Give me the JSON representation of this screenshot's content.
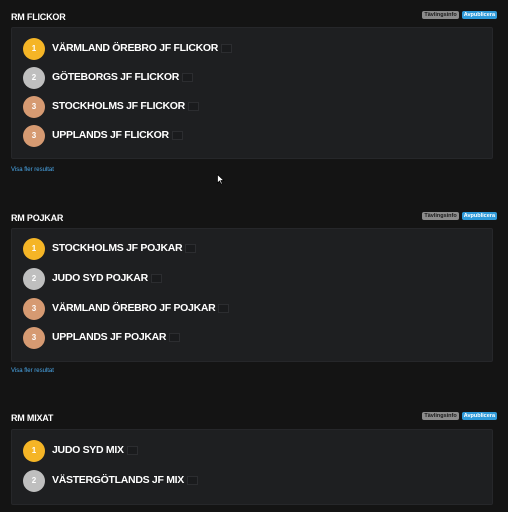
{
  "sections": [
    {
      "title": "RM FLICKOR",
      "badges": [
        "Tävlingsinfo",
        "Avpublicera"
      ],
      "results": [
        {
          "place": "1",
          "medal": "gold",
          "team": "VÄRMLAND ÖREBRO JF FLICKOR"
        },
        {
          "place": "2",
          "medal": "silver",
          "team": "GÖTEBORGS JF FLICKOR"
        },
        {
          "place": "3",
          "medal": "bronze",
          "team": "STOCKHOLMS JF FLICKOR"
        },
        {
          "place": "3",
          "medal": "bronze",
          "team": "UPPLANDS JF FLICKOR"
        }
      ],
      "more_link": "Visa fler resultat"
    },
    {
      "title": "RM POJKAR",
      "badges": [
        "Tävlingsinfo",
        "Avpublicera"
      ],
      "results": [
        {
          "place": "1",
          "medal": "gold",
          "team": "STOCKHOLMS JF POJKAR"
        },
        {
          "place": "2",
          "medal": "silver",
          "team": "JUDO SYD POJKAR"
        },
        {
          "place": "3",
          "medal": "bronze",
          "team": "VÄRMLAND ÖREBRO JF POJKAR"
        },
        {
          "place": "3",
          "medal": "bronze",
          "team": "UPPLANDS JF POJKAR"
        }
      ],
      "more_link": "Visa fler resultat"
    },
    {
      "title": "RM MIXAT",
      "badges": [
        "Tävlingsinfo",
        "Avpublicera"
      ],
      "results": [
        {
          "place": "1",
          "medal": "gold",
          "team": "JUDO SYD MIX"
        },
        {
          "place": "2",
          "medal": "silver",
          "team": "VÄSTERGÖTLANDS JF MIX"
        }
      ]
    }
  ],
  "colors": {
    "background": "#141414",
    "card": "#1e1f21",
    "gold": "#f5b526",
    "silver": "#bfbfbf",
    "bronze": "#d69a72",
    "badge_grey": "#8c8c8c",
    "badge_blue": "#2f9ad8",
    "link": "#4aa8ea"
  }
}
